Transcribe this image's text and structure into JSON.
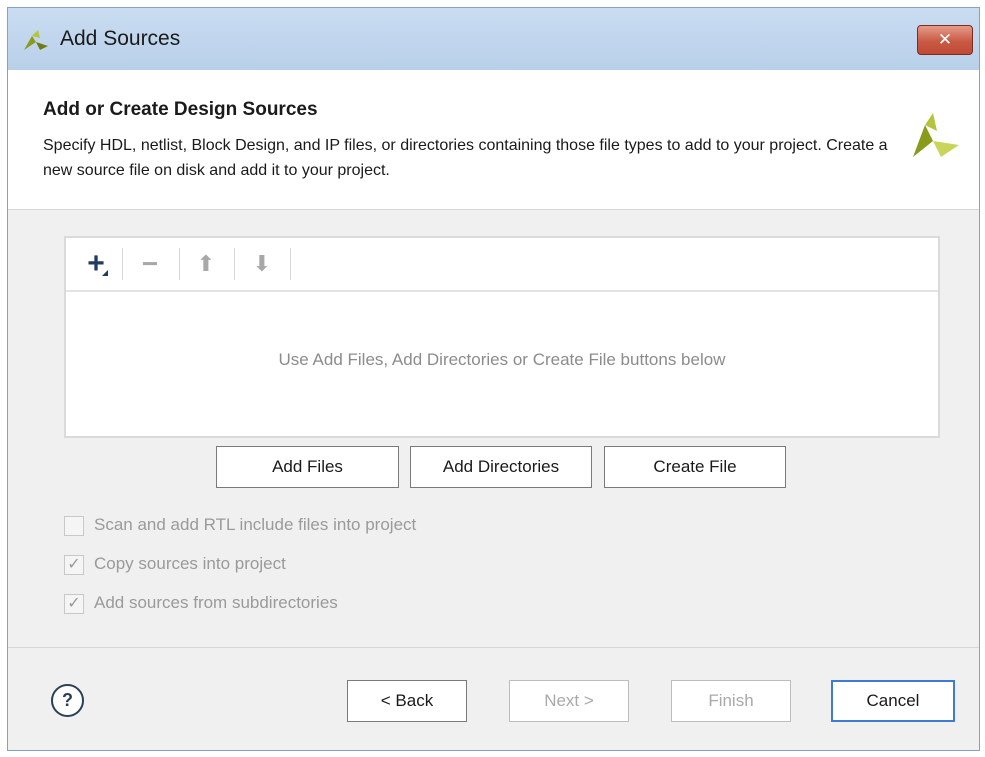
{
  "window": {
    "title": "Add Sources",
    "close_label": "✕"
  },
  "header": {
    "title": "Add or Create Design Sources",
    "description": "Specify HDL, netlist, Block Design, and IP files, or directories containing those file types to add to your project. Create a new source file on disk and add it to your project."
  },
  "toolbar": {
    "add_icon": "plus-icon",
    "remove_icon": "minus-icon",
    "up_icon": "arrow-up-icon",
    "down_icon": "arrow-down-icon"
  },
  "file_list": {
    "empty_message": "Use Add Files, Add Directories or Create File buttons below"
  },
  "actions": {
    "add_files": "Add Files",
    "add_directories": "Add Directories",
    "create_file": "Create File"
  },
  "options": [
    {
      "label": "Scan and add RTL include files into project",
      "checked": false
    },
    {
      "label": "Copy sources into project",
      "checked": true
    },
    {
      "label": "Add sources from subdirectories",
      "checked": true
    }
  ],
  "footer": {
    "help_label": "?",
    "back": "< Back",
    "next": "Next >",
    "finish": "Finish",
    "cancel": "Cancel"
  },
  "colors": {
    "title_bar": "#c9dcf1",
    "close_button": "#c85a44",
    "logo_green": "#8a9a1a",
    "primary_border": "#3d7bd4"
  }
}
